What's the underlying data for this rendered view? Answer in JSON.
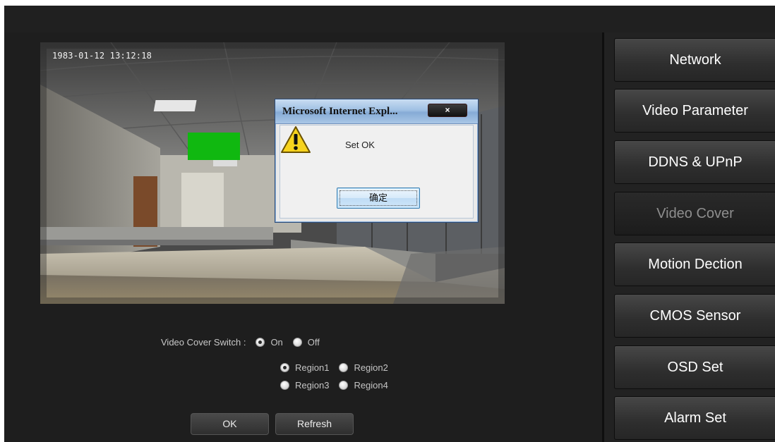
{
  "video": {
    "timestamp": "1983-01-12 13:12:18",
    "cover_color": "#10b810"
  },
  "dialog": {
    "title": "Microsoft Internet Expl...",
    "close_label": "×",
    "message": "Set OK",
    "ok_label": "确定",
    "icon": "warning-icon"
  },
  "controls": {
    "switch_label": "Video Cover Switch :",
    "switch_options": [
      {
        "label": "On",
        "checked": true
      },
      {
        "label": "Off",
        "checked": false
      }
    ],
    "regions": [
      {
        "label": "Region1",
        "checked": true
      },
      {
        "label": "Region2",
        "checked": false
      },
      {
        "label": "Region3",
        "checked": false
      },
      {
        "label": "Region4",
        "checked": false
      }
    ],
    "ok_label": "OK",
    "refresh_label": "Refresh"
  },
  "menu": {
    "items": [
      {
        "label": "Network",
        "active": false
      },
      {
        "label": "Video Parameter",
        "active": false
      },
      {
        "label": "DDNS & UPnP",
        "active": false
      },
      {
        "label": "Video Cover",
        "active": true
      },
      {
        "label": "Motion Dection",
        "active": false
      },
      {
        "label": "CMOS Sensor",
        "active": false
      },
      {
        "label": "OSD Set",
        "active": false
      },
      {
        "label": "Alarm Set",
        "active": false
      }
    ]
  }
}
